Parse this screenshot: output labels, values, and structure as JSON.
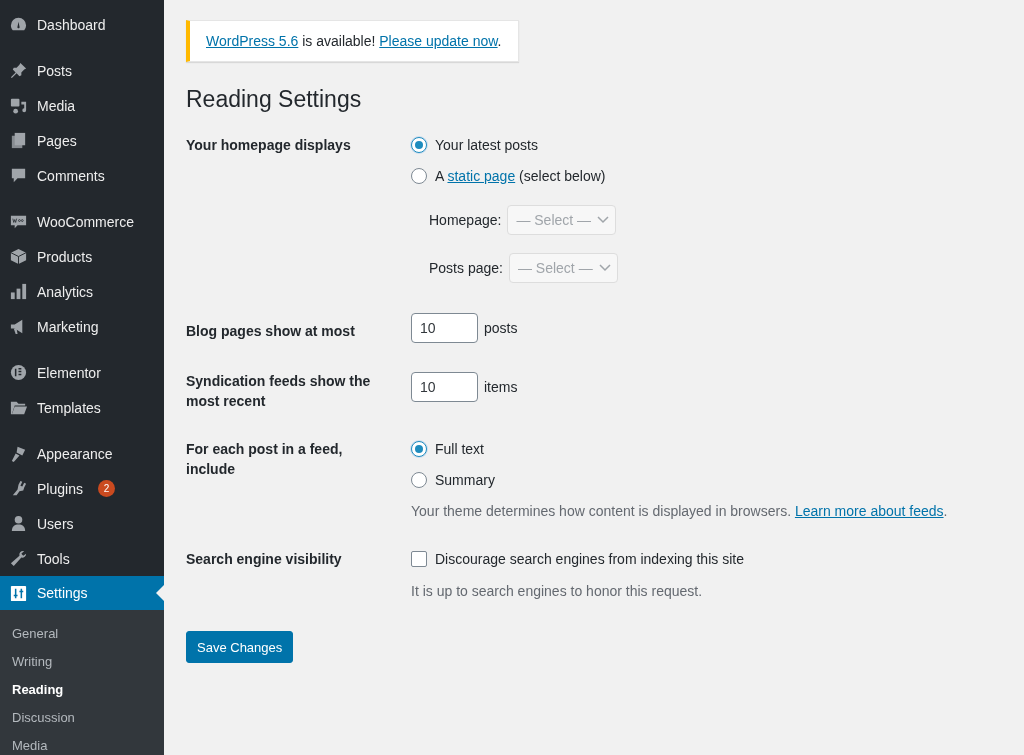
{
  "sidebar": {
    "groups": [
      [
        {
          "label": "Dashboard",
          "selected": false
        }
      ],
      [
        {
          "label": "Posts",
          "selected": false
        },
        {
          "label": "Media",
          "selected": false
        },
        {
          "label": "Pages",
          "selected": false
        },
        {
          "label": "Comments",
          "selected": false
        }
      ],
      [
        {
          "label": "WooCommerce",
          "selected": false
        },
        {
          "label": "Products",
          "selected": false
        },
        {
          "label": "Analytics",
          "selected": false
        },
        {
          "label": "Marketing",
          "selected": false
        }
      ],
      [
        {
          "label": "Elementor",
          "selected": false
        },
        {
          "label": "Templates",
          "selected": false
        }
      ],
      [
        {
          "label": "Appearance",
          "selected": false
        },
        {
          "label": "Plugins",
          "selected": false,
          "badge": "2"
        },
        {
          "label": "Users",
          "selected": false
        },
        {
          "label": "Tools",
          "selected": false
        },
        {
          "label": "Settings",
          "selected": true
        }
      ]
    ],
    "submenu": [
      {
        "label": "General",
        "selected": false
      },
      {
        "label": "Writing",
        "selected": false
      },
      {
        "label": "Reading",
        "selected": true
      },
      {
        "label": "Discussion",
        "selected": false
      },
      {
        "label": "Media",
        "selected": false
      }
    ]
  },
  "notice": {
    "segments": [
      {
        "text": "WordPress 5.6",
        "link": true
      },
      {
        "text": " is available! ",
        "link": false
      },
      {
        "text": "Please update now",
        "link": true
      },
      {
        "text": ".",
        "link": false
      }
    ]
  },
  "title": "Reading Settings",
  "settings": [
    {
      "label": "Your homepage displays",
      "kind": "radio_group",
      "options": [
        {
          "selected": true,
          "segments": [
            {
              "text": "Your latest posts",
              "link": false
            }
          ]
        },
        {
          "selected": false,
          "segments": [
            {
              "text": "A ",
              "link": false
            },
            {
              "text": "static page",
              "link": true
            },
            {
              "text": " (select below)",
              "link": false
            }
          ]
        }
      ],
      "selects": [
        {
          "label": "Homepage:",
          "value": "— Select —",
          "disabled": true
        },
        {
          "label": "Posts page:",
          "value": "— Select —",
          "disabled": true
        }
      ]
    },
    {
      "label": "Blog pages show at most",
      "kind": "number",
      "value": "10",
      "unit": "posts"
    },
    {
      "label": "Syndication feeds show the most recent",
      "kind": "number",
      "value": "10",
      "unit": "items"
    },
    {
      "label": "For each post in a feed, include",
      "kind": "radio_group",
      "options": [
        {
          "selected": true,
          "segments": [
            {
              "text": "Full text",
              "link": false
            }
          ]
        },
        {
          "selected": false,
          "segments": [
            {
              "text": "Summary",
              "link": false
            }
          ]
        }
      ],
      "description": [
        {
          "text": "Your theme determines how content is displayed in browsers. ",
          "link": false
        },
        {
          "text": "Learn more about feeds",
          "link": true
        },
        {
          "text": ".",
          "link": false
        }
      ]
    },
    {
      "label": "Search engine visibility",
      "kind": "checkbox",
      "option": "Discourage search engines from indexing this site",
      "checked": false,
      "description": [
        {
          "text": "It is up to search engines to honor this request.",
          "link": false
        }
      ]
    }
  ],
  "save_button": "Save Changes"
}
